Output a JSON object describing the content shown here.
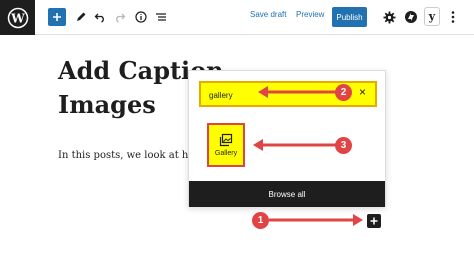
{
  "toolbar": {
    "logo_icon": "wordpress-logo-icon",
    "save_draft_label": "Save draft",
    "preview_label": "Preview",
    "publish_label": "Publish",
    "yoast_letter": "y"
  },
  "post": {
    "title_line1": "Add Caption",
    "title_line2": "Images",
    "paragraph": "In this posts, we look at how"
  },
  "inserter": {
    "search_value": "gallery",
    "clear_symbol": "×",
    "result_label": "Gallery",
    "browse_all_label": "Browse all"
  },
  "annotations": {
    "step1": "1",
    "step2": "2",
    "step3": "3"
  },
  "colors": {
    "accent": "#2271b1",
    "highlight": "#ffff00",
    "annotation": "#e14444",
    "dark": "#1e1e1e"
  }
}
